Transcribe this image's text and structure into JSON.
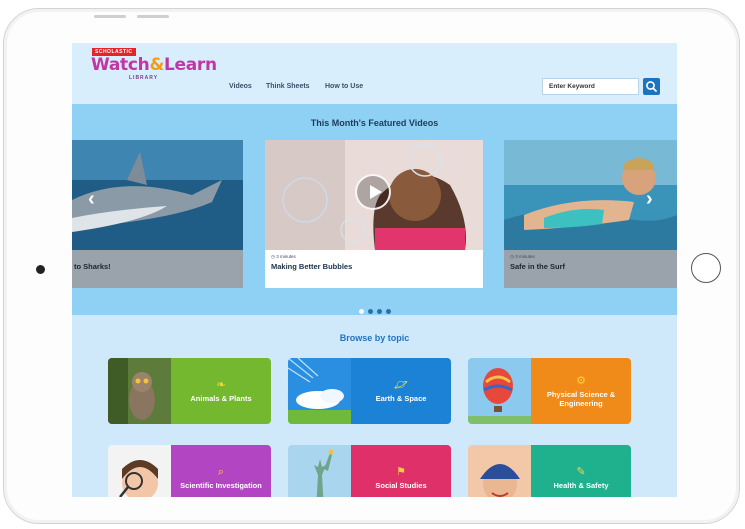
{
  "site": {
    "brand_tag": "SCHOLASTIC",
    "logo_main": "Watch",
    "logo_amp": "&",
    "logo_end": "Learn",
    "logo_sub": "LIBRARY"
  },
  "nav": {
    "items": [
      "Videos",
      "Think Sheets",
      "How to Use"
    ]
  },
  "search": {
    "placeholder": "Enter Keyword"
  },
  "featured": {
    "title": "This Month's Featured Videos",
    "cards": [
      {
        "title": "to Sharks!",
        "duration": ""
      },
      {
        "title": "Making Better Bubbles",
        "duration": "3 minutes"
      },
      {
        "title": "Safe in the Surf",
        "duration": "3 minutes"
      }
    ],
    "dots": 4,
    "active_dot": 0
  },
  "browse": {
    "title": "Browse by topic",
    "topics": [
      {
        "label": "Animals & Plants",
        "color": "#74b830",
        "icon": "leaf-icon"
      },
      {
        "label": "Earth & Space",
        "color": "#1c82d6",
        "icon": "planet-icon"
      },
      {
        "label": "Physical Science & Engineering",
        "color": "#f08a18",
        "icon": "gear-icon"
      },
      {
        "label": "Scientific Investigation",
        "color": "#b245c2",
        "icon": "magnifier-icon"
      },
      {
        "label": "Social Studies",
        "color": "#e0306a",
        "icon": "flag-icon"
      },
      {
        "label": "Health & Safety",
        "color": "#1fb08d",
        "icon": "toothbrush-icon"
      }
    ]
  },
  "colors": {
    "accent": "#1e73be",
    "featured_bg": "#8fd0f5",
    "screen_bg": "#cfe9fb"
  }
}
